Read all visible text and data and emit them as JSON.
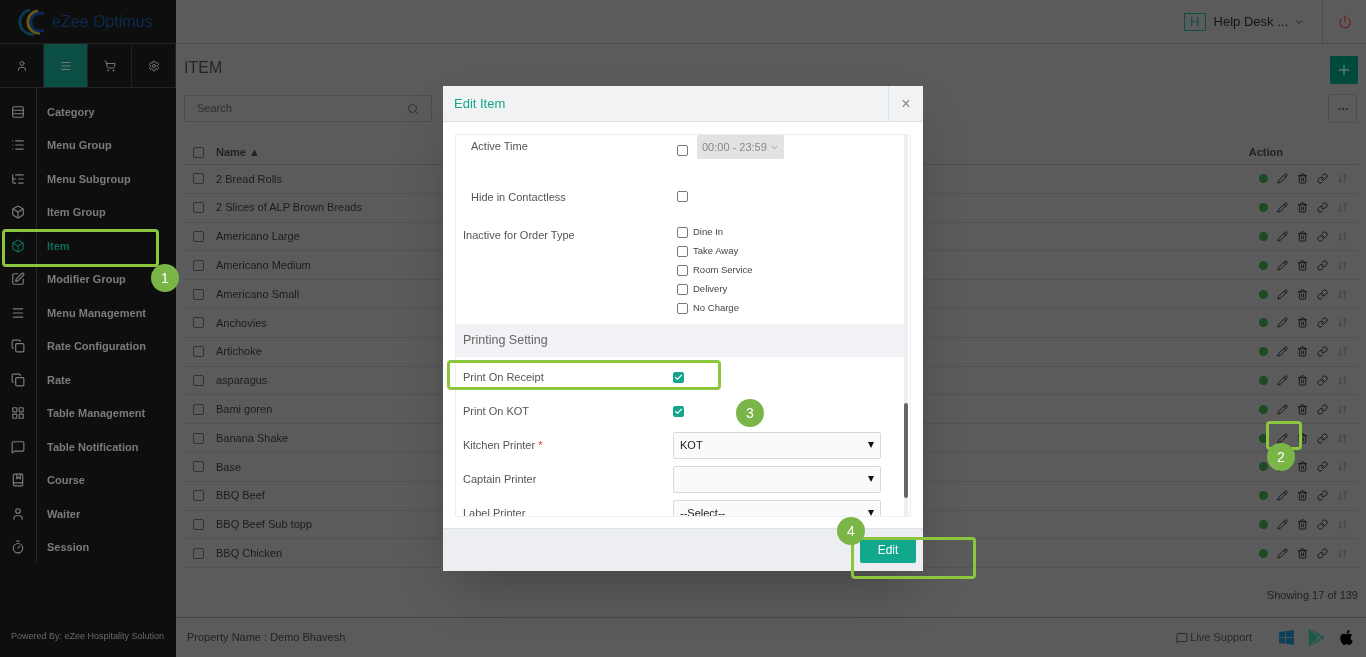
{
  "brand": "eZee Optimus",
  "top_tabs": [
    {
      "selected": false
    },
    {
      "selected": true
    },
    {
      "selected": false
    },
    {
      "selected": false
    }
  ],
  "sidebar": {
    "items": [
      {
        "label": "Category",
        "selected": false
      },
      {
        "label": "Menu Group",
        "selected": false
      },
      {
        "label": "Menu Subgroup",
        "selected": false
      },
      {
        "label": "Item Group",
        "selected": false
      },
      {
        "label": "Item",
        "selected": true
      },
      {
        "label": "Modifier Group",
        "selected": false
      },
      {
        "label": "Menu Management",
        "selected": false
      },
      {
        "label": "Rate Configuration",
        "selected": false
      },
      {
        "label": "Rate",
        "selected": false
      },
      {
        "label": "Table Management",
        "selected": false
      },
      {
        "label": "Table Notification",
        "selected": false
      },
      {
        "label": "Course",
        "selected": false
      },
      {
        "label": "Waiter",
        "selected": false
      },
      {
        "label": "Session",
        "selected": false
      }
    ],
    "powered_by": "Powered By: eZee Hospitality Solution"
  },
  "header": {
    "badge": "H",
    "user": "Help Desk ..."
  },
  "page_title": "ITEM",
  "search": {
    "placeholder": "Search"
  },
  "table": {
    "select_all_checked": false,
    "columns": [
      "Name ▲",
      "Action"
    ],
    "rows": [
      {
        "name": "2 Bread Rolls",
        "checked": false
      },
      {
        "name": "2 Slices of ALP Brown Breads",
        "checked": false
      },
      {
        "name": "Americano Large",
        "checked": false
      },
      {
        "name": "Americano Medium",
        "checked": false
      },
      {
        "name": "Americano Small",
        "checked": false
      },
      {
        "name": "Anchovies",
        "checked": false
      },
      {
        "name": "Artichoke",
        "checked": false
      },
      {
        "name": "asparagus",
        "checked": false
      },
      {
        "name": "Bami goren",
        "checked": false
      },
      {
        "name": "Banana Shake",
        "checked": false
      },
      {
        "name": "Base",
        "checked": false
      },
      {
        "name": "BBQ Beef",
        "checked": false
      },
      {
        "name": "BBQ Beef Sub topp",
        "checked": false
      },
      {
        "name": "BBQ Chicken",
        "checked": false
      }
    ],
    "footer": "Showing 17 of 139"
  },
  "status_bar": {
    "property": "Property Name : Demo Bhavesh",
    "support": "Live Support"
  },
  "modal": {
    "title": "Edit Item",
    "close": "×",
    "required_mark": "*",
    "active_time": {
      "label": "Active Time",
      "checked": false,
      "disabled": true,
      "value": "00:00 - 23:59"
    },
    "hide_in_contactless": {
      "label": "Hide in Contactless",
      "checked": false
    },
    "order_type": {
      "label": "Inactive for Order Type",
      "options": [
        {
          "label": "Dine In",
          "checked": false
        },
        {
          "label": "Take Away",
          "checked": false
        },
        {
          "label": "Room Service",
          "checked": false
        },
        {
          "label": "Delivery",
          "checked": false
        },
        {
          "label": "No Charge",
          "checked": false
        }
      ]
    },
    "printing": {
      "title": "Printing Setting",
      "fields": [
        {
          "kind": "checkbox",
          "label": "Print On Receipt",
          "checked": true
        },
        {
          "kind": "checkbox",
          "label": "Print On KOT",
          "checked": true
        },
        {
          "kind": "select",
          "label": "Kitchen Printer",
          "required": true,
          "value": "KOT"
        },
        {
          "kind": "select",
          "label": "Captain Printer",
          "required": false
        },
        {
          "kind": "select",
          "label": "Label Printer",
          "required": false,
          "value": "--Select--"
        }
      ]
    },
    "submit": "Edit"
  },
  "annotations": [
    {
      "label": "1"
    },
    {
      "label": "2"
    },
    {
      "label": "3"
    },
    {
      "label": "4"
    }
  ]
}
